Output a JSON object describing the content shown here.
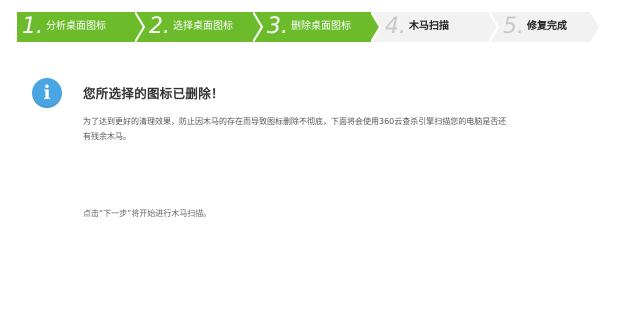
{
  "steps": [
    {
      "num": "1.",
      "label": "分析桌面图标",
      "state": "done"
    },
    {
      "num": "2.",
      "label": "选择桌面图标",
      "state": "done"
    },
    {
      "num": "3.",
      "label": "删除桌面图标",
      "state": "current"
    },
    {
      "num": "4.",
      "label": "木马扫描",
      "state": "pending"
    },
    {
      "num": "5.",
      "label": "修复完成",
      "state": "pending"
    }
  ],
  "colors": {
    "active_step": "#6bbb2b",
    "pending_step": "#f2f2f2",
    "info_icon": "#4aa6e2"
  },
  "icon": "info-icon",
  "message": {
    "title": "您所选择的图标已删除！",
    "description": "为了达到更好的清理效果，防止因木马的存在而导致图标删除不彻底，下面将会使用360云查杀引擎扫描您的电脑是否还有残余木马。",
    "hint": "点击“下一步”将开始进行木马扫描。"
  }
}
